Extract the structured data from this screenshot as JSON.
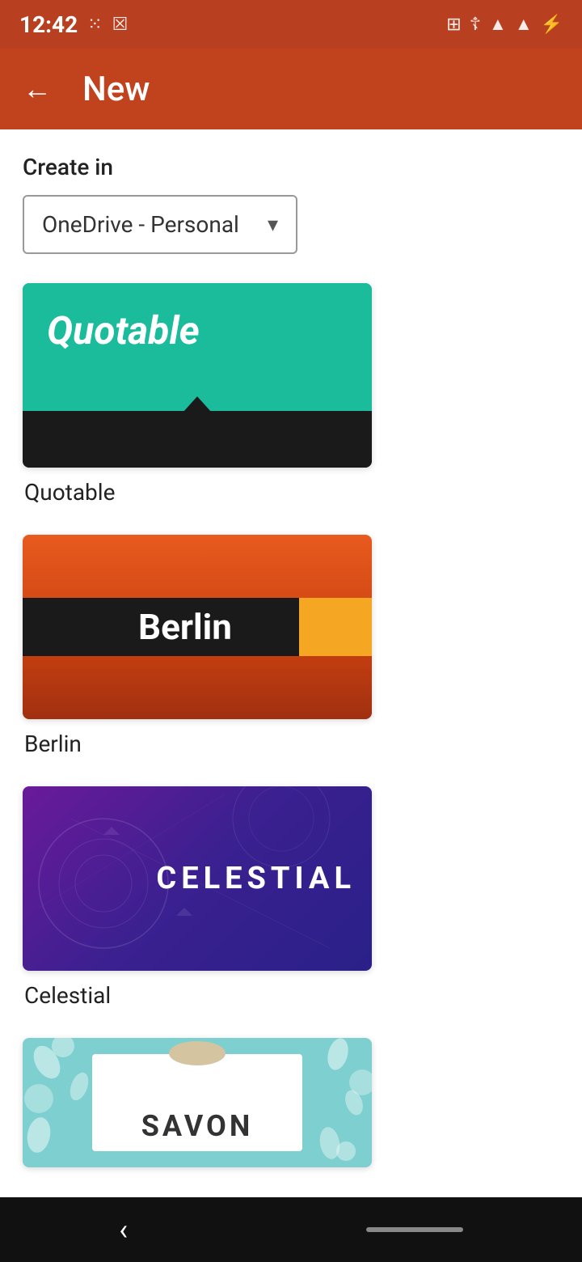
{
  "status_bar": {
    "time": "12:42",
    "icons": [
      "signal",
      "cast",
      "vibrate",
      "wifi",
      "signal-strength",
      "battery"
    ]
  },
  "app_bar": {
    "back_label": "←",
    "title": "New"
  },
  "content": {
    "create_in_label": "Create in",
    "dropdown": {
      "value": "OneDrive - Personal",
      "arrow": "▾"
    },
    "templates": [
      {
        "id": "quotable",
        "name": "Quotable",
        "label": "Quotable"
      },
      {
        "id": "berlin",
        "name": "Berlin",
        "label": "Berlin"
      },
      {
        "id": "celestial",
        "name": "Celestial",
        "label": "Celestial"
      },
      {
        "id": "savon",
        "name": "Savon",
        "label": "SAVON"
      }
    ]
  }
}
